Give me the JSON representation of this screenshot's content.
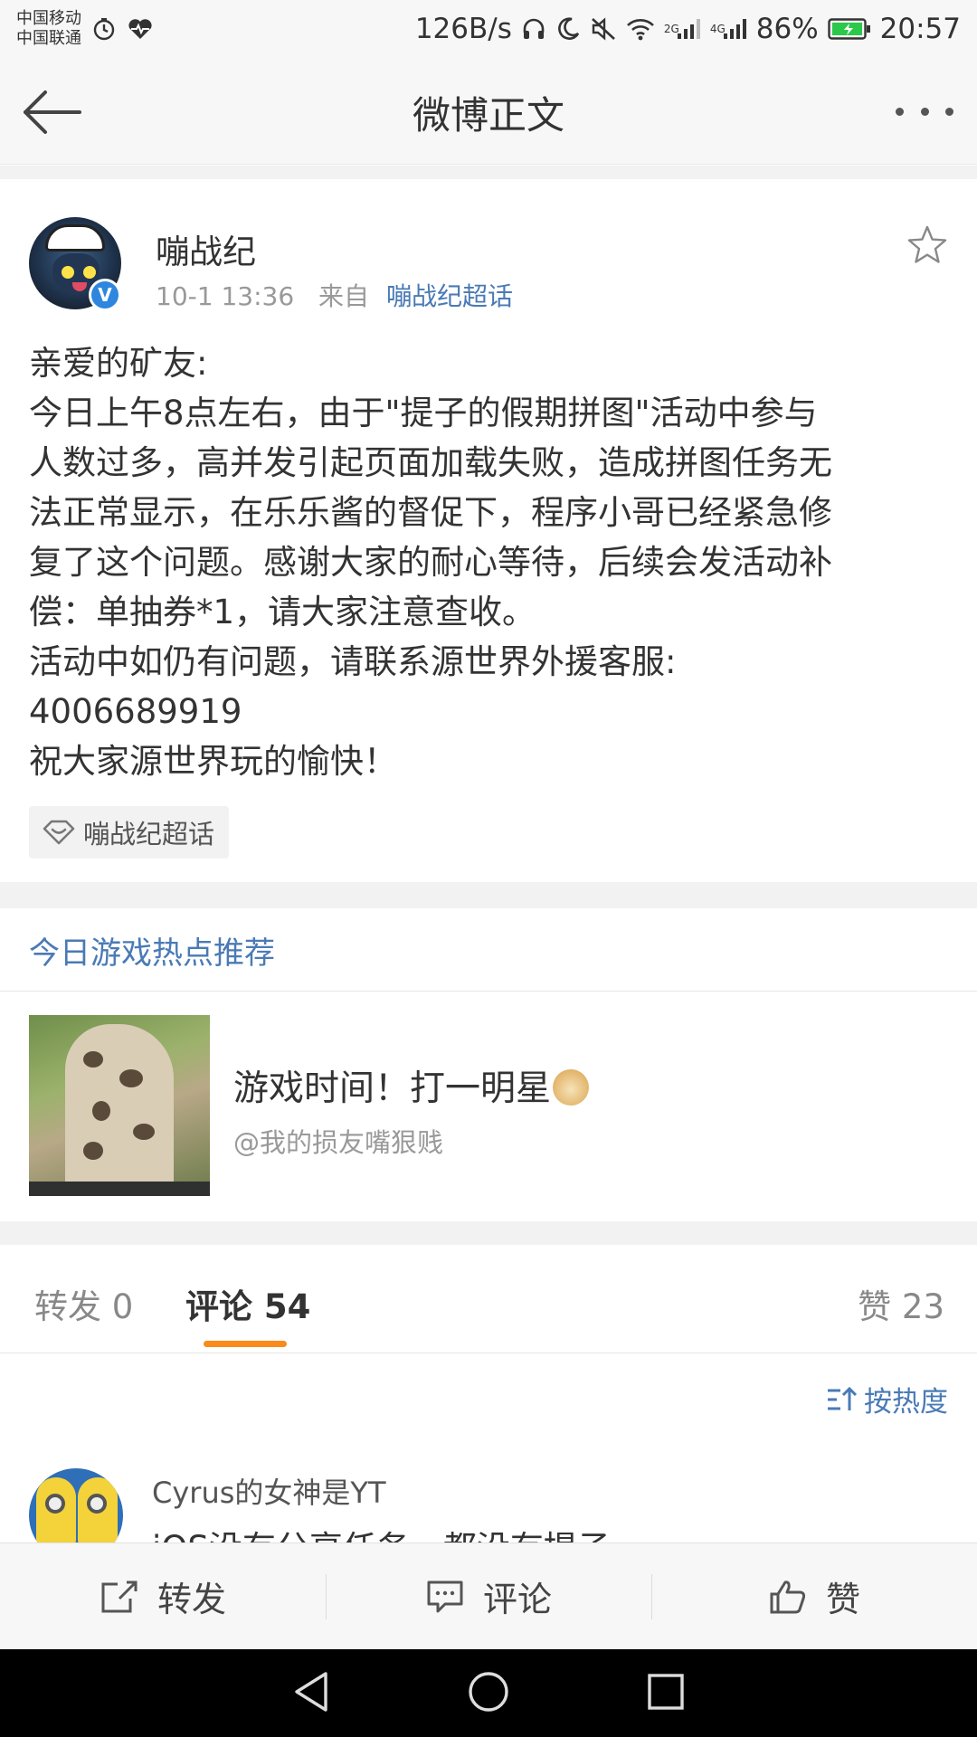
{
  "status_bar": {
    "carrier_1": "中国移动",
    "carrier_2": "中国联通",
    "net_speed": "126B/s",
    "battery": "86%",
    "time": "20:57",
    "signal_2g": "2G",
    "signal_4g": "4G"
  },
  "app_bar": {
    "title": "微博正文"
  },
  "post": {
    "author": "嘣战纪",
    "time": "10-1 13:36",
    "from_prefix": "来自",
    "source": "嘣战纪超话",
    "verified_mark": "V",
    "lines": [
      "亲爱的矿友:",
      "今日上午8点左右，由于\"提子的假期拼图\"活动中参与",
      "人数过多，高并发引起页面加载失败，造成拼图任务无",
      "法正常显示，在乐乐酱的督促下，程序小哥已经紧急修",
      "复了这个问题。感谢大家的耐心等待，后续会发活动补",
      "偿：单抽券*1，请大家注意查收。",
      "活动中如仍有问题，请联系源世界外援客服:",
      "4006689919",
      "祝大家源世界玩的愉快！"
    ],
    "topic_tag": "嘣战纪超话"
  },
  "recommend": {
    "header": "今日游戏热点推荐",
    "title": "游戏时间！打一明星",
    "subtitle": "@我的损友嘴狠贱"
  },
  "tabs": {
    "repost": "转发 0",
    "comment": "评论 54",
    "like": "赞 23"
  },
  "sort": {
    "label": "按热度"
  },
  "comment": {
    "author": "Cyrus的女神是YT",
    "text": "iOS没有分享任务，都没有提子"
  },
  "actions": {
    "repost": "转发",
    "comment": "评论",
    "like": "赞"
  },
  "colors": {
    "link_blue": "#4a7ab5",
    "tab_accent": "#fa8a1a",
    "battery_green": "#2bc84a",
    "verified_blue": "#2e86de"
  }
}
